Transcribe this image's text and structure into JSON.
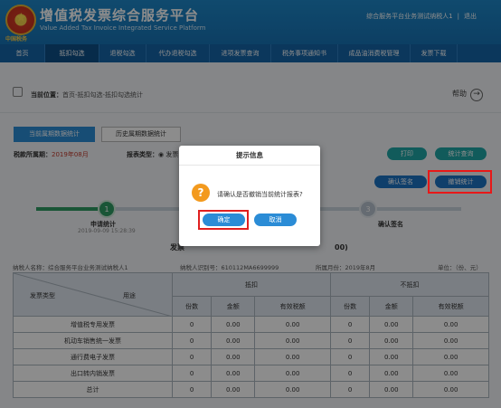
{
  "header": {
    "title": "增值税发票综合服务平台",
    "title_en": "Value Added Tax Invoice Integrated Service Platform",
    "logo_text": "中国税务",
    "user_name": "综合服务平台业务测试纳税人1",
    "logout": "退出"
  },
  "nav": {
    "items": [
      {
        "label": "首页"
      },
      {
        "label": "抵扣勾选"
      },
      {
        "label": "退税勾选"
      },
      {
        "label": "代办退税勾选"
      },
      {
        "label": "进项发票查询"
      },
      {
        "label": "税务事项通知书"
      },
      {
        "label": "成品油消费税管理"
      },
      {
        "label": "发票下载"
      }
    ]
  },
  "breadcrumb": {
    "prefix": "当前位置：",
    "path": "首页-抵扣勾选-抵扣勾选统计",
    "help": "帮助"
  },
  "tabs": {
    "current": "当前属期数据统计",
    "history": "历史属期数据统计"
  },
  "period": {
    "label": "税款所属期：",
    "value": "2019年08月",
    "type_label": "报表类型：",
    "type_value": "◉ 发票"
  },
  "actions": {
    "print": "打印",
    "stat_query": "统计查询",
    "confirm_sign": "确认签名",
    "revoke_stat": "撤销统计"
  },
  "steps": {
    "s1_num": "1",
    "s1_label": "申请统计",
    "s1_date": "2019-09-09 15:28:39",
    "s3_num": "3",
    "s3_label": "确认签名"
  },
  "report": {
    "title": "发票",
    "title_tail": "00)",
    "taxpayer_label": "纳税人名称：综合服务平台业务测试纳税人1",
    "taxid_label": "纳税人识别号：610112MA6699999",
    "month_label": "所属月份：2019年8月",
    "unit_label": "单位：（份、元）"
  },
  "table": {
    "corner_left": "发票类型",
    "corner_right": "用途",
    "group_deduct": "抵扣",
    "group_nondeduct": "不抵扣",
    "cols": [
      "份数",
      "金额",
      "有效税额",
      "份数",
      "金额",
      "有效税额"
    ],
    "rows": [
      {
        "type": "增值税专用发票",
        "v": [
          "0",
          "0.00",
          "0.00",
          "0",
          "0.00",
          "0.00"
        ]
      },
      {
        "type": "机动车销售统一发票",
        "v": [
          "0",
          "0.00",
          "0.00",
          "0",
          "0.00",
          "0.00"
        ]
      },
      {
        "type": "通行费电子发票",
        "v": [
          "0",
          "0.00",
          "0.00",
          "0",
          "0.00",
          "0.00"
        ]
      },
      {
        "type": "出口转内销发票",
        "v": [
          "0",
          "0.00",
          "0.00",
          "0",
          "0.00",
          "0.00"
        ]
      },
      {
        "type": "总计",
        "v": [
          "0",
          "0.00",
          "0.00",
          "0",
          "0.00",
          "0.00"
        ]
      }
    ]
  },
  "dialog": {
    "title": "提示信息",
    "icon": "?",
    "message": "请确认是否撤销当前统计报表?",
    "ok": "确定",
    "cancel": "取消"
  },
  "colors": {
    "header_blue": "#1773b5",
    "nav_blue": "#1565a8",
    "accent_blue": "#2b8cd6",
    "teal": "#1fa6a6",
    "highlight_red": "#e02020",
    "step_green": "#2e9b63",
    "warning_orange": "#f39a1e"
  }
}
